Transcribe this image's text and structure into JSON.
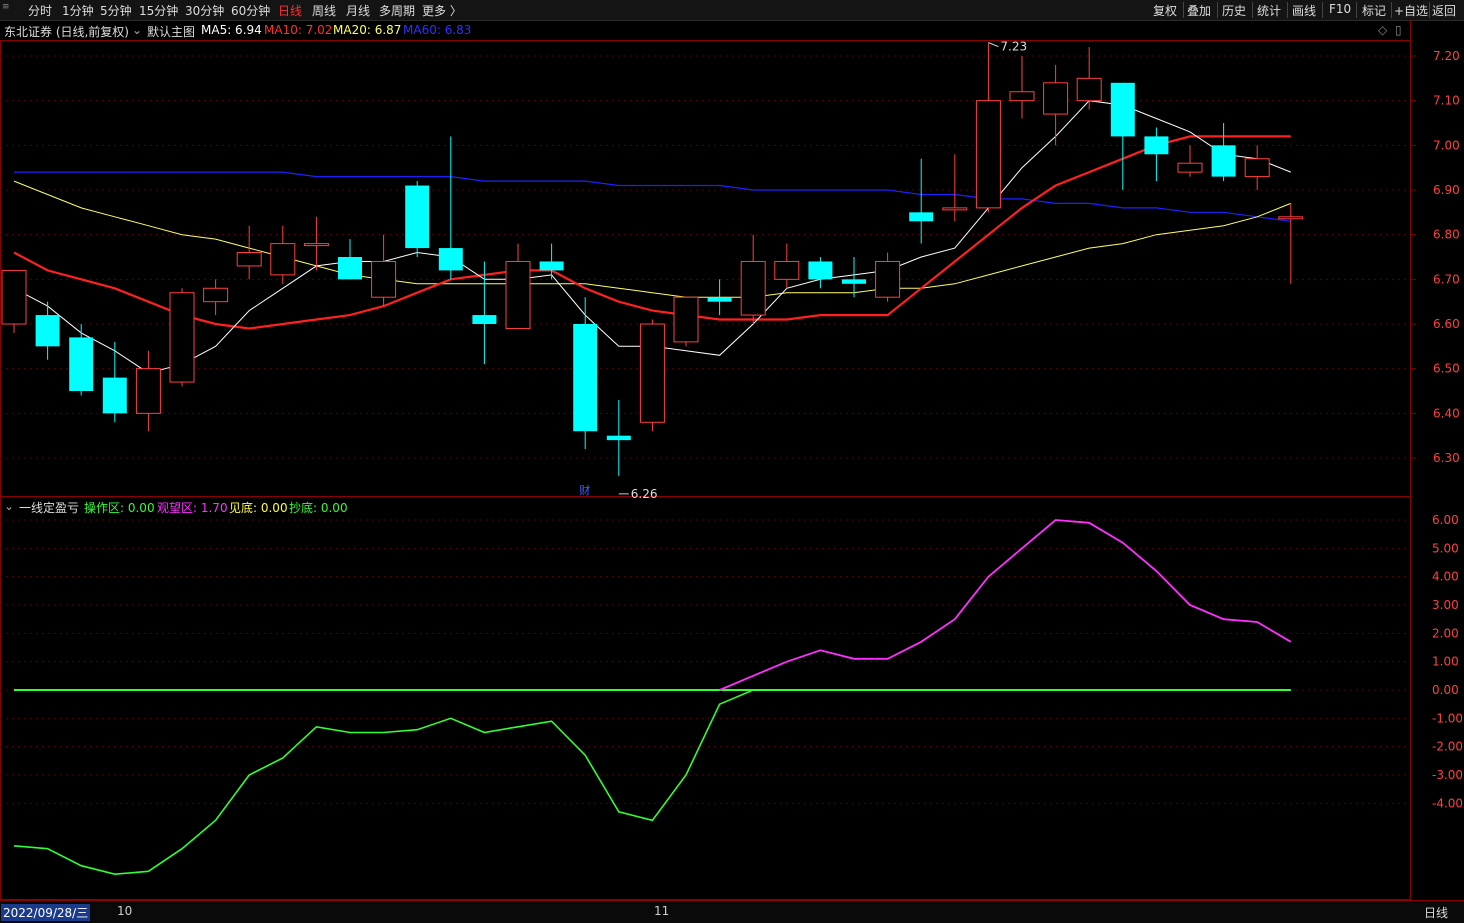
{
  "toolbar": {
    "left": [
      "分时",
      "1分钟",
      "5分钟",
      "15分钟",
      "30分钟",
      "60分钟",
      "日线",
      "周线",
      "月线",
      "多周期",
      "更多 〉"
    ],
    "active": "日线",
    "right": [
      "复权",
      "叠加",
      "历史",
      "统计",
      "画线",
      "F10",
      "标记",
      "+自选",
      "返回"
    ]
  },
  "info": {
    "stock": "东北证券 (日线,前复权)",
    "main_label": "默认主图",
    "ma5": "MA5: 6.94",
    "ma10": "MA10: 7.02",
    "ma20": "MA20: 6.87",
    "ma60": "MA60: 6.83"
  },
  "indicator": {
    "name": "一线定盈亏",
    "op": "操作区: 0.00",
    "watch": "观望区: 1.70",
    "seebottom": "见底: 0.00",
    "copy": "抄底: 0.00"
  },
  "annotations": {
    "high": "7.23",
    "low": "6.26",
    "cai": "财"
  },
  "bottom": {
    "date": "2022/09/28/三",
    "m10": "10",
    "m11": "11",
    "period": "日线"
  },
  "colors": {
    "up": "#ff4040",
    "down": "#00ffff",
    "ma5": "#ffffff",
    "ma10": "#ff2020",
    "ma20": "#ffff60",
    "ma60": "#2020ff",
    "watch": "#ff30ff",
    "op": "#30ff30"
  },
  "chart_data": {
    "type": "candlestick",
    "price_axis": [
      "7.20",
      "7.10",
      "7.00",
      "6.90",
      "6.80",
      "6.70",
      "6.60",
      "6.50",
      "6.40",
      "6.30"
    ],
    "indicator_axis": [
      "6.00",
      "5.00",
      "4.00",
      "3.00",
      "2.00",
      "1.00",
      "0.00",
      "-1.00",
      "-2.00",
      "-3.00",
      "-4.00"
    ],
    "candles": [
      {
        "o": 6.6,
        "c": 6.72,
        "h": 6.72,
        "l": 6.58
      },
      {
        "o": 6.62,
        "c": 6.55,
        "h": 6.65,
        "l": 6.52
      },
      {
        "o": 6.57,
        "c": 6.45,
        "h": 6.6,
        "l": 6.44
      },
      {
        "o": 6.48,
        "c": 6.4,
        "h": 6.56,
        "l": 6.38
      },
      {
        "o": 6.4,
        "c": 6.5,
        "h": 6.54,
        "l": 6.36
      },
      {
        "o": 6.47,
        "c": 6.67,
        "h": 6.68,
        "l": 6.46
      },
      {
        "o": 6.65,
        "c": 6.68,
        "h": 6.7,
        "l": 6.62
      },
      {
        "o": 6.73,
        "c": 6.76,
        "h": 6.82,
        "l": 6.7
      },
      {
        "o": 6.71,
        "c": 6.78,
        "h": 6.82,
        "l": 6.69
      },
      {
        "o": 6.78,
        "c": 6.78,
        "h": 6.84,
        "l": 6.72
      },
      {
        "o": 6.75,
        "c": 6.7,
        "h": 6.79,
        "l": 6.7
      },
      {
        "o": 6.66,
        "c": 6.74,
        "h": 6.8,
        "l": 6.64
      },
      {
        "o": 6.91,
        "c": 6.77,
        "h": 6.92,
        "l": 6.75
      },
      {
        "o": 6.77,
        "c": 6.72,
        "h": 7.02,
        "l": 6.7
      },
      {
        "o": 6.62,
        "c": 6.6,
        "h": 6.74,
        "l": 6.51
      },
      {
        "o": 6.59,
        "c": 6.74,
        "h": 6.78,
        "l": 6.59
      },
      {
        "o": 6.74,
        "c": 6.72,
        "h": 6.78,
        "l": 6.7
      },
      {
        "o": 6.6,
        "c": 6.36,
        "h": 6.66,
        "l": 6.32
      },
      {
        "o": 6.35,
        "c": 6.34,
        "h": 6.43,
        "l": 6.26
      },
      {
        "o": 6.38,
        "c": 6.6,
        "h": 6.61,
        "l": 6.36
      },
      {
        "o": 6.56,
        "c": 6.66,
        "h": 6.66,
        "l": 6.55
      },
      {
        "o": 6.66,
        "c": 6.65,
        "h": 6.7,
        "l": 6.62
      },
      {
        "o": 6.62,
        "c": 6.74,
        "h": 6.8,
        "l": 6.6
      },
      {
        "o": 6.7,
        "c": 6.74,
        "h": 6.78,
        "l": 6.68
      },
      {
        "o": 6.74,
        "c": 6.7,
        "h": 6.75,
        "l": 6.68
      },
      {
        "o": 6.7,
        "c": 6.69,
        "h": 6.75,
        "l": 6.66
      },
      {
        "o": 6.66,
        "c": 6.74,
        "h": 6.76,
        "l": 6.65
      },
      {
        "o": 6.85,
        "c": 6.83,
        "h": 6.97,
        "l": 6.78
      },
      {
        "o": 6.86,
        "c": 6.86,
        "h": 6.98,
        "l": 6.83
      },
      {
        "o": 6.86,
        "c": 7.1,
        "h": 7.23,
        "l": 6.85
      },
      {
        "o": 7.1,
        "c": 7.12,
        "h": 7.2,
        "l": 7.06
      },
      {
        "o": 7.07,
        "c": 7.14,
        "h": 7.18,
        "l": 7.0
      },
      {
        "o": 7.1,
        "c": 7.15,
        "h": 7.22,
        "l": 7.08
      },
      {
        "o": 7.14,
        "c": 7.02,
        "h": 7.14,
        "l": 6.9
      },
      {
        "o": 7.02,
        "c": 6.98,
        "h": 7.04,
        "l": 6.92
      },
      {
        "o": 6.94,
        "c": 6.96,
        "h": 7.0,
        "l": 6.93
      },
      {
        "o": 7.0,
        "c": 6.93,
        "h": 7.05,
        "l": 6.92
      },
      {
        "o": 6.93,
        "c": 6.97,
        "h": 7.0,
        "l": 6.9
      },
      {
        "o": 6.84,
        "c": 6.84,
        "h": 6.87,
        "l": 6.69
      }
    ],
    "ma5": [
      6.68,
      6.64,
      6.58,
      6.54,
      6.49,
      6.51,
      6.55,
      6.63,
      6.68,
      6.73,
      6.74,
      6.74,
      6.76,
      6.75,
      6.7,
      6.7,
      6.71,
      6.62,
      6.55,
      6.55,
      6.54,
      6.53,
      6.6,
      6.68,
      6.7,
      6.71,
      6.72,
      6.75,
      6.77,
      6.86,
      6.95,
      7.02,
      7.1,
      7.09,
      7.06,
      7.03,
      6.98,
      6.97,
      6.94
    ],
    "ma10": [
      6.76,
      6.72,
      6.7,
      6.68,
      6.65,
      6.62,
      6.6,
      6.59,
      6.6,
      6.61,
      6.62,
      6.64,
      6.67,
      6.7,
      6.71,
      6.72,
      6.72,
      6.68,
      6.65,
      6.63,
      6.62,
      6.61,
      6.61,
      6.61,
      6.62,
      6.62,
      6.62,
      6.68,
      6.74,
      6.8,
      6.86,
      6.91,
      6.94,
      6.97,
      7.0,
      7.02,
      7.02,
      7.02,
      7.02
    ],
    "ma20": [
      6.92,
      6.89,
      6.86,
      6.84,
      6.82,
      6.8,
      6.79,
      6.77,
      6.75,
      6.73,
      6.71,
      6.7,
      6.69,
      6.69,
      6.69,
      6.69,
      6.69,
      6.69,
      6.68,
      6.67,
      6.66,
      6.66,
      6.66,
      6.67,
      6.67,
      6.67,
      6.68,
      6.68,
      6.69,
      6.71,
      6.73,
      6.75,
      6.77,
      6.78,
      6.8,
      6.81,
      6.82,
      6.84,
      6.87
    ],
    "ma60": [
      6.94,
      6.94,
      6.94,
      6.94,
      6.94,
      6.94,
      6.94,
      6.94,
      6.94,
      6.93,
      6.93,
      6.93,
      6.93,
      6.93,
      6.92,
      6.92,
      6.92,
      6.92,
      6.91,
      6.91,
      6.91,
      6.91,
      6.9,
      6.9,
      6.9,
      6.9,
      6.9,
      6.89,
      6.89,
      6.88,
      6.88,
      6.87,
      6.87,
      6.86,
      6.86,
      6.85,
      6.85,
      6.84,
      6.83
    ],
    "op_line": [
      -5.5,
      -5.6,
      -6.2,
      -6.5,
      -6.4,
      -5.6,
      -4.6,
      -3.0,
      -2.4,
      -1.3,
      -1.5,
      -1.5,
      -1.4,
      -1.0,
      -1.5,
      -1.3,
      -1.1,
      -2.3,
      -4.3,
      -4.6,
      -3.0,
      -0.5,
      0,
      0,
      0,
      0,
      0,
      0,
      0,
      0,
      0,
      0,
      0,
      0,
      0,
      0,
      0,
      0,
      0
    ],
    "watch_line": [
      null,
      null,
      null,
      null,
      null,
      null,
      null,
      null,
      null,
      null,
      null,
      null,
      null,
      null,
      null,
      null,
      null,
      null,
      null,
      null,
      null,
      0.0,
      0.5,
      1.0,
      1.4,
      1.1,
      1.1,
      1.7,
      2.5,
      4.0,
      5.0,
      6.0,
      5.9,
      5.2,
      4.2,
      3.0,
      2.5,
      2.4,
      1.7
    ],
    "zero_line": 0
  }
}
